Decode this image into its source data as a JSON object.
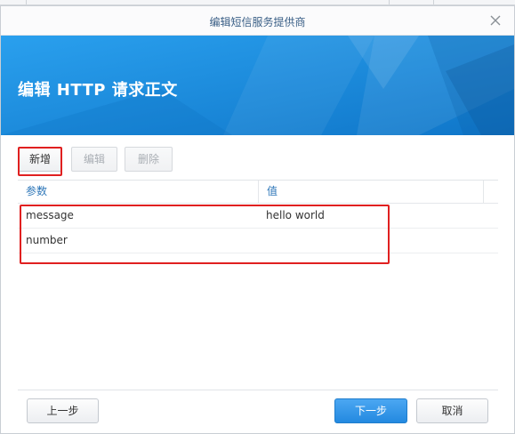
{
  "dialog": {
    "title": "编辑短信服务提供商",
    "heading": "编辑 HTTP 请求正文"
  },
  "toolbar": {
    "add_label": "新增",
    "edit_label": "编辑",
    "delete_label": "删除"
  },
  "table": {
    "columns": [
      "参数",
      "值"
    ],
    "rows": [
      {
        "param": "message",
        "value": "hello world"
      },
      {
        "param": "number",
        "value": ""
      }
    ]
  },
  "footer": {
    "prev_label": "上一步",
    "next_label": "下一步",
    "cancel_label": "取消"
  },
  "colors": {
    "accent": "#2389e0",
    "banner": "#1a8fe0",
    "highlight": "#e02020"
  }
}
